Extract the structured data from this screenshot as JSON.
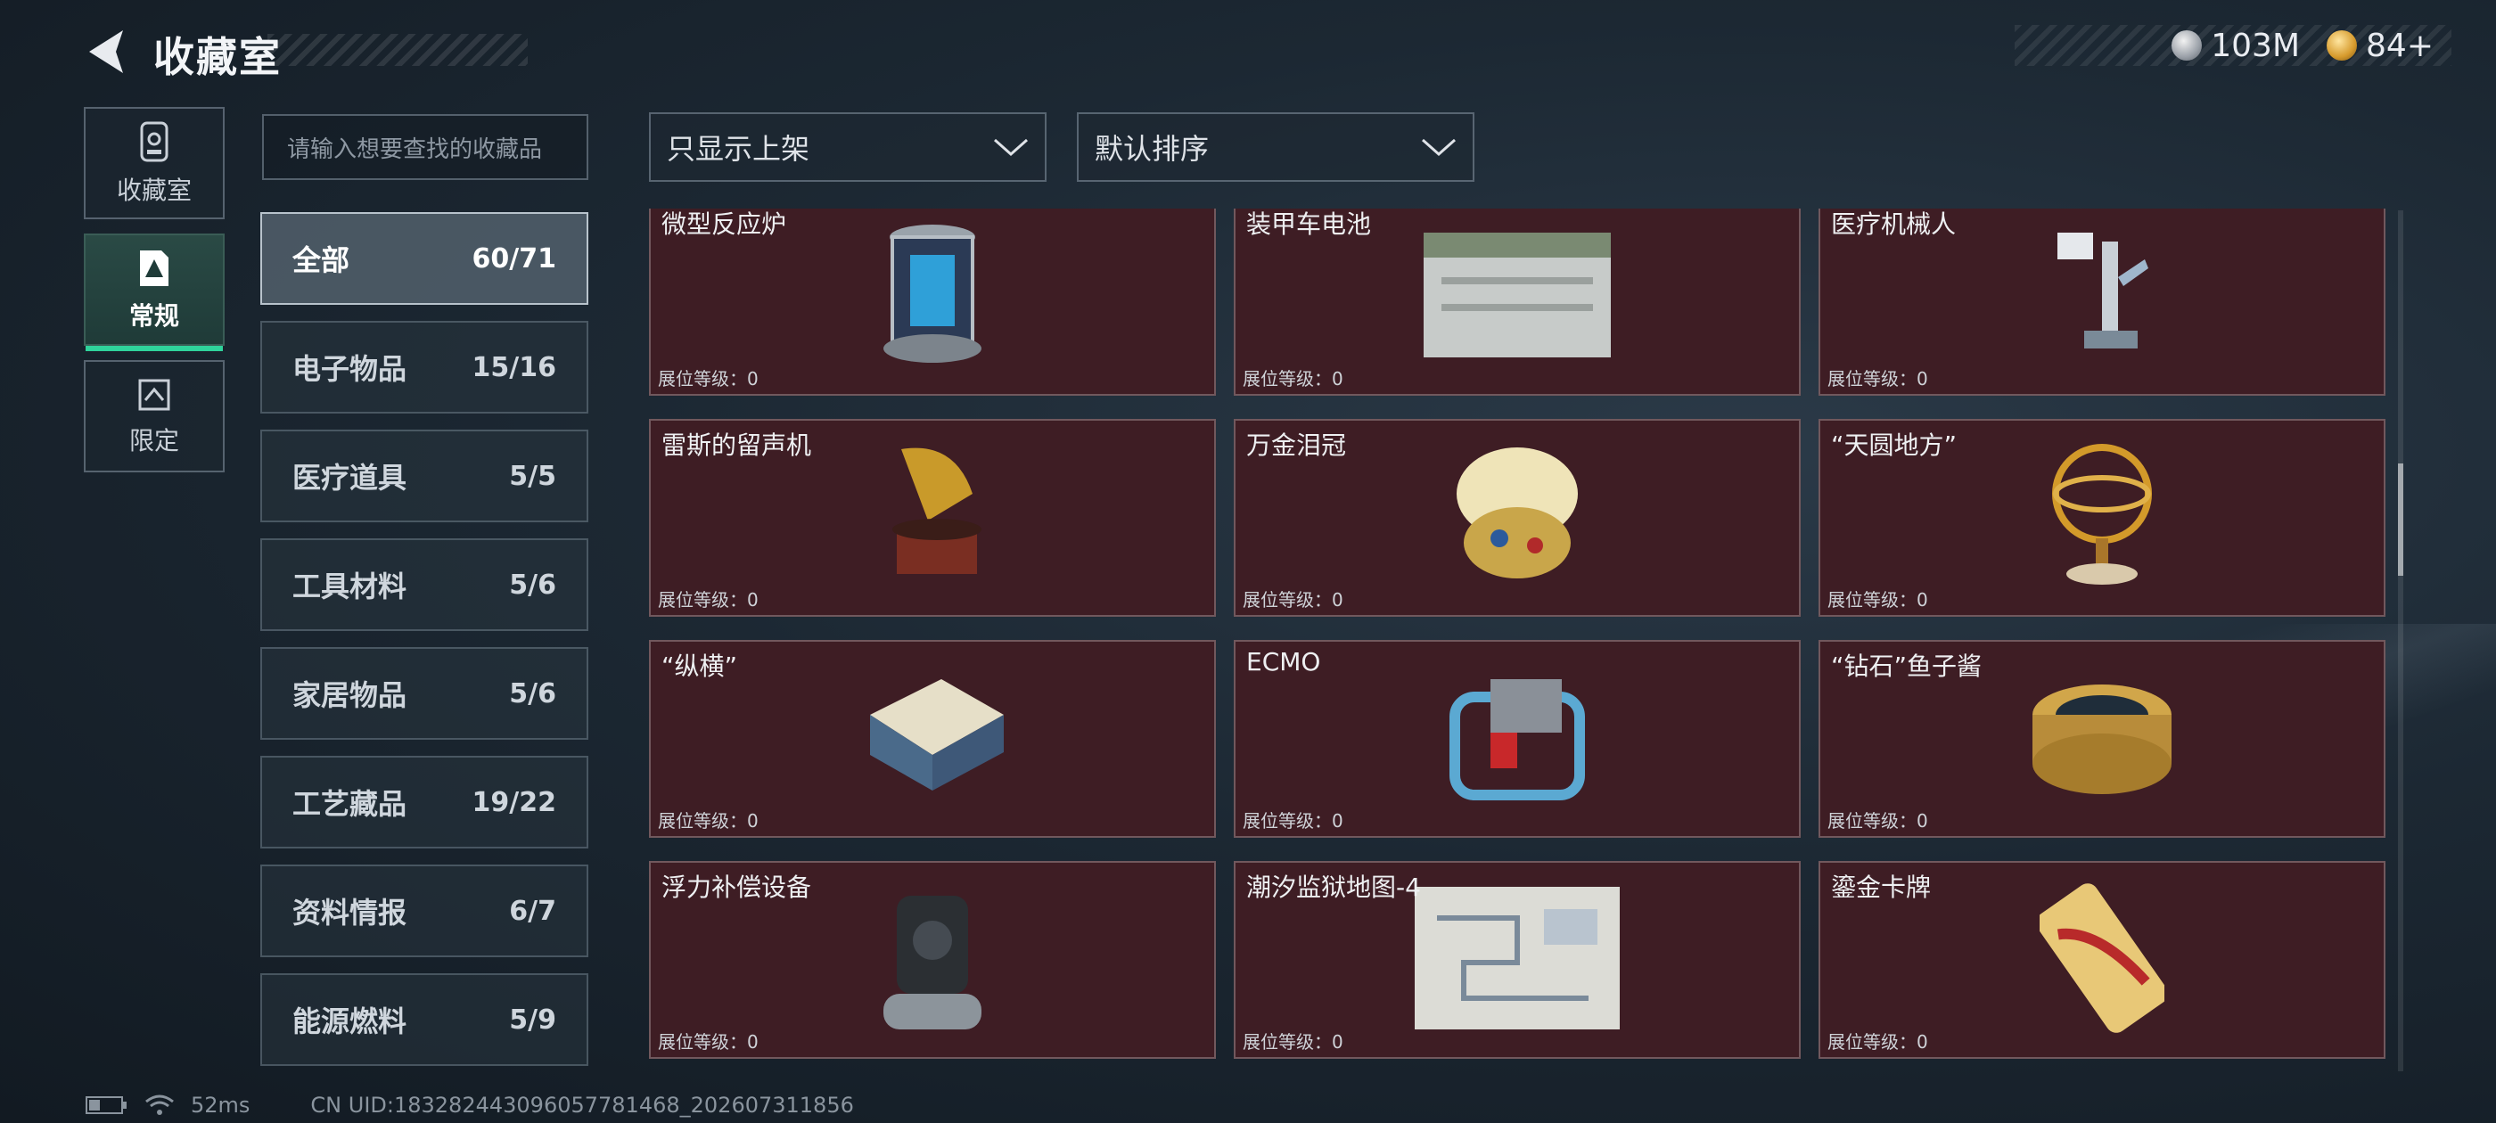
{
  "header": {
    "title": "收藏室"
  },
  "currency": [
    {
      "icon": "silver-coin-icon",
      "value": "103M"
    },
    {
      "icon": "gold-coin-icon",
      "value": "84+"
    }
  ],
  "nav": [
    {
      "label": "收藏室",
      "icon": "collection-icon"
    },
    {
      "label": "常规",
      "icon": "regular-icon",
      "active": true
    },
    {
      "label": "限定",
      "icon": "limited-icon"
    }
  ],
  "search": {
    "placeholder": "请输入想要查找的收藏品"
  },
  "filters": {
    "show_filter": "只显示上架",
    "sort": "默认排序"
  },
  "categories": [
    {
      "label": "全部",
      "count": "60/71",
      "active": true
    },
    {
      "label": "电子物品",
      "count": "15/16"
    },
    {
      "label": "医疗道具",
      "count": "5/5"
    },
    {
      "label": "工具材料",
      "count": "5/6"
    },
    {
      "label": "家居物品",
      "count": "5/6"
    },
    {
      "label": "工艺藏品",
      "count": "19/22"
    },
    {
      "label": "资料情报",
      "count": "6/7"
    },
    {
      "label": "能源燃料",
      "count": "5/9"
    }
  ],
  "items": [
    {
      "name": "微型反应炉",
      "level": "展位等级：0",
      "icon": "reactor-icon"
    },
    {
      "name": "装甲车电池",
      "level": "展位等级：0",
      "icon": "battery-icon"
    },
    {
      "name": "医疗机械人",
      "level": "展位等级：0",
      "icon": "medical-robot-icon"
    },
    {
      "name": "雷斯的留声机",
      "level": "展位等级：0",
      "icon": "gramophone-icon"
    },
    {
      "name": "万金泪冠",
      "level": "展位等级：0",
      "icon": "jeweled-egg-icon"
    },
    {
      "name": "“天圆地方”",
      "level": "展位等级：0",
      "icon": "armillary-sphere-icon"
    },
    {
      "name": "“纵横”",
      "level": "展位等级：0",
      "icon": "chessboard-icon"
    },
    {
      "name": "ECMO",
      "level": "展位等级：0",
      "icon": "ecmo-icon"
    },
    {
      "name": "“钻石”鱼子酱",
      "level": "展位等级：0",
      "icon": "caviar-tin-icon"
    },
    {
      "name": "浮力补偿设备",
      "level": "展位等级：0",
      "icon": "bcd-icon"
    },
    {
      "name": "潮汐监狱地图-4",
      "level": "展位等级：0",
      "icon": "map-icon"
    },
    {
      "name": "鎏金卡牌",
      "level": "展位等级：0",
      "icon": "gold-card-icon"
    }
  ],
  "footer": {
    "ping": "52ms",
    "uid": "CN UID:1832824430960577814​68_202607311856"
  }
}
